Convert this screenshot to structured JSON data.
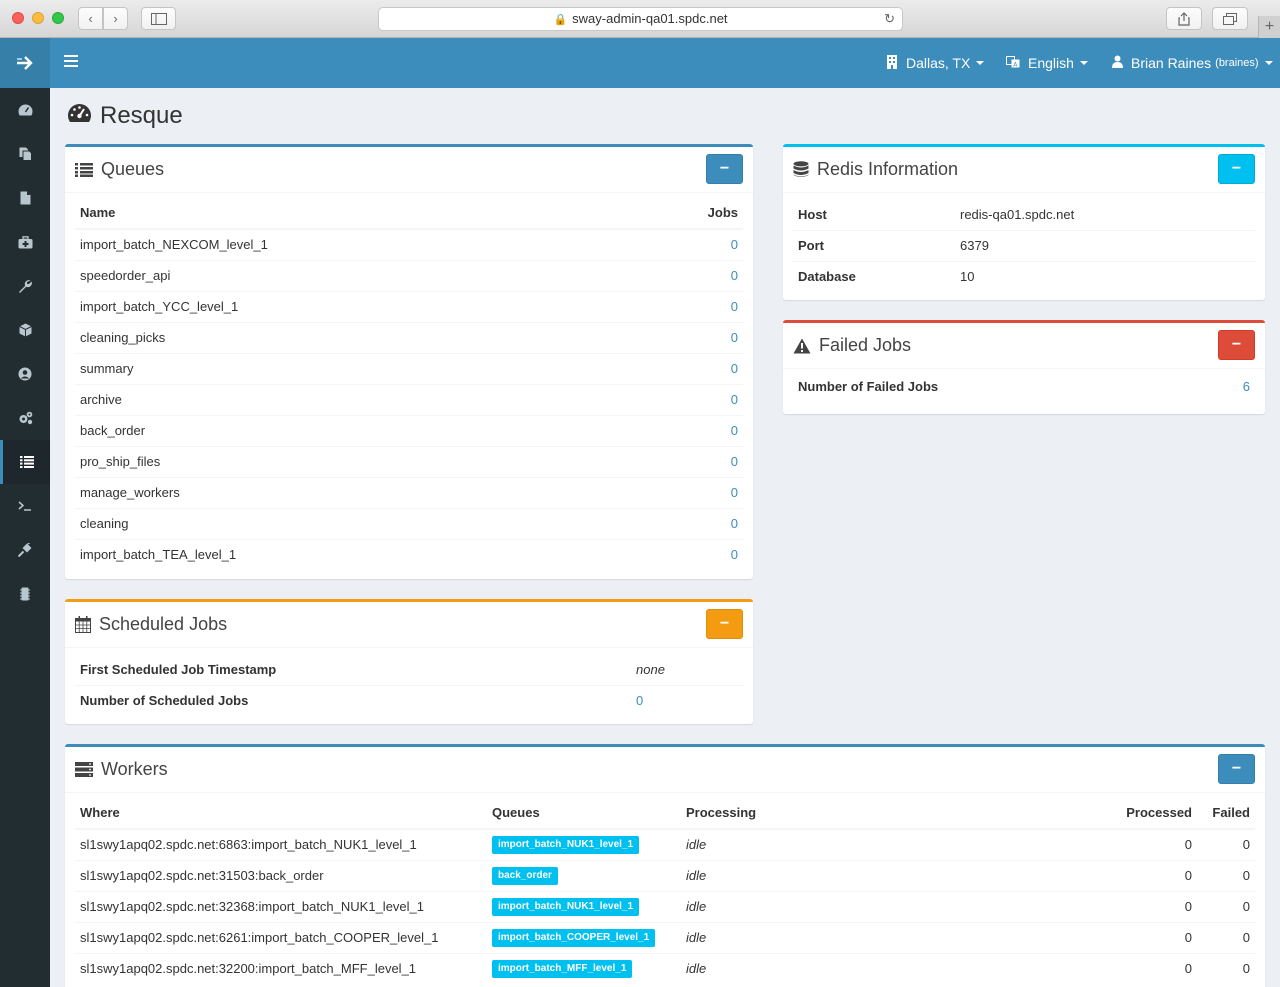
{
  "browser": {
    "url": "sway-admin-qa01.spdc.net",
    "back": "‹",
    "forward": "›",
    "new_tab": "+"
  },
  "topbar": {
    "location": "Dallas, TX",
    "language": "English",
    "user_name": "Brian Raines",
    "user_handle": "(braines)"
  },
  "sidebar": {
    "items": [
      {
        "icon": "dashboard-icon"
      },
      {
        "icon": "copy-icon"
      },
      {
        "icon": "file-icon"
      },
      {
        "icon": "medkit-icon"
      },
      {
        "icon": "wrench-icon"
      },
      {
        "icon": "cube-icon"
      },
      {
        "icon": "user-circle-icon"
      },
      {
        "icon": "cogs-icon"
      },
      {
        "icon": "list-icon",
        "active": true
      },
      {
        "icon": "terminal-icon"
      },
      {
        "icon": "plug-icon"
      },
      {
        "icon": "microchip-icon"
      }
    ]
  },
  "page": {
    "title": "Resque"
  },
  "queues": {
    "title": "Queues",
    "col_name": "Name",
    "col_jobs": "Jobs",
    "rows": [
      {
        "name": "import_batch_NEXCOM_level_1",
        "jobs": "0"
      },
      {
        "name": "speedorder_api",
        "jobs": "0"
      },
      {
        "name": "import_batch_YCC_level_1",
        "jobs": "0"
      },
      {
        "name": "cleaning_picks",
        "jobs": "0"
      },
      {
        "name": "summary",
        "jobs": "0"
      },
      {
        "name": "archive",
        "jobs": "0"
      },
      {
        "name": "back_order",
        "jobs": "0"
      },
      {
        "name": "pro_ship_files",
        "jobs": "0"
      },
      {
        "name": "manage_workers",
        "jobs": "0"
      },
      {
        "name": "cleaning",
        "jobs": "0"
      },
      {
        "name": "import_batch_TEA_level_1",
        "jobs": "0"
      }
    ]
  },
  "redis": {
    "title": "Redis Information",
    "host_label": "Host",
    "host_value": "redis-qa01.spdc.net",
    "port_label": "Port",
    "port_value": "6379",
    "db_label": "Database",
    "db_value": "10"
  },
  "failed": {
    "title": "Failed Jobs",
    "count_label": "Number of Failed Jobs",
    "count_value": "6"
  },
  "scheduled": {
    "title": "Scheduled Jobs",
    "first_label": "First Scheduled Job Timestamp",
    "first_value": "none",
    "count_label": "Number of Scheduled Jobs",
    "count_value": "0"
  },
  "workers": {
    "title": "Workers",
    "col_where": "Where",
    "col_queues": "Queues",
    "col_processing": "Processing",
    "col_processed": "Processed",
    "col_failed": "Failed",
    "rows": [
      {
        "where": "sl1swy1apq02.spdc.net:6863:import_batch_NUK1_level_1",
        "queue": "import_batch_NUK1_level_1",
        "processing": "idle",
        "processed": "0",
        "failed": "0"
      },
      {
        "where": "sl1swy1apq02.spdc.net:31503:back_order",
        "queue": "back_order",
        "processing": "idle",
        "processed": "0",
        "failed": "0"
      },
      {
        "where": "sl1swy1apq02.spdc.net:32368:import_batch_NUK1_level_1",
        "queue": "import_batch_NUK1_level_1",
        "processing": "idle",
        "processed": "0",
        "failed": "0"
      },
      {
        "where": "sl1swy1apq02.spdc.net:6261:import_batch_COOPER_level_1",
        "queue": "import_batch_COOPER_level_1",
        "processing": "idle",
        "processed": "0",
        "failed": "0"
      },
      {
        "where": "sl1swy1apq02.spdc.net:32200:import_batch_MFF_level_1",
        "queue": "import_batch_MFF_level_1",
        "processing": "idle",
        "processed": "0",
        "failed": "0"
      }
    ]
  },
  "colors": {
    "primary": "#3c8dbc",
    "info": "#00c0ef",
    "danger": "#dd4b39",
    "warning": "#f39c12",
    "sidebar_bg": "#222d32"
  }
}
